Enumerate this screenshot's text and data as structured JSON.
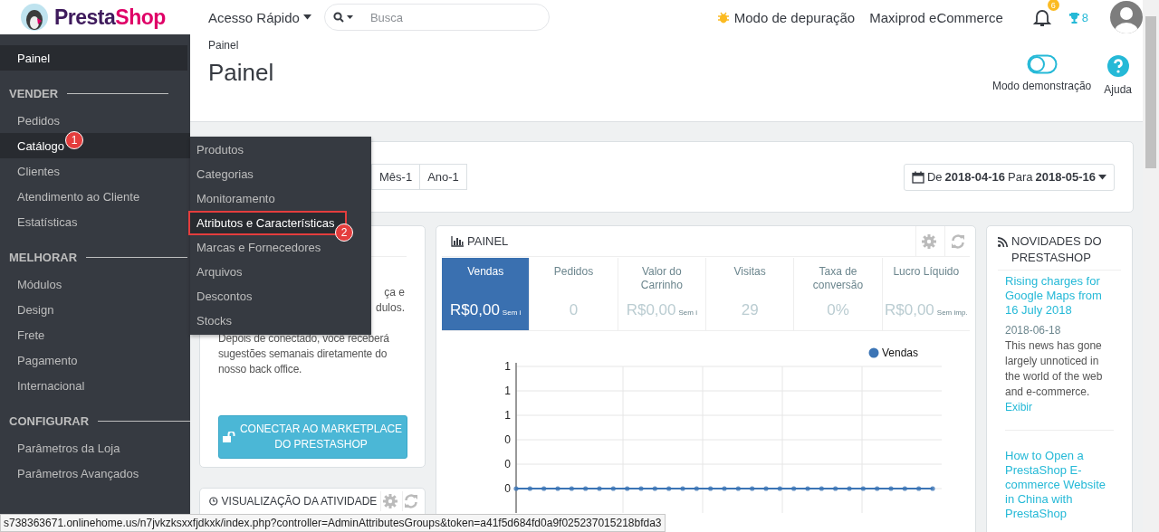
{
  "header": {
    "logo": [
      "Presta",
      "Shop"
    ],
    "quick_access": "Acesso Rápido",
    "search": {
      "placeholder": "Busca"
    },
    "debug_mode": "Modo de depuração",
    "shop_name": "Maxiprod eCommerce",
    "notifications_count": "6",
    "trophy_count": "8"
  },
  "sidebar": {
    "items": [
      {
        "label": "Painel",
        "selected": true
      },
      {
        "kind": "section",
        "label": "VENDER"
      },
      {
        "label": "Pedidos",
        "selected": false
      },
      {
        "label": "Catálogo",
        "selected": true,
        "badge": "1"
      },
      {
        "label": "Clientes",
        "selected": false
      },
      {
        "label": "Atendimento ao Cliente",
        "selected": false
      },
      {
        "label": "Estatísticas",
        "selected": false
      },
      {
        "kind": "section",
        "label": "MELHORAR"
      },
      {
        "label": "Módulos",
        "selected": false
      },
      {
        "label": "Design",
        "selected": false
      },
      {
        "label": "Frete",
        "selected": false
      },
      {
        "label": "Pagamento",
        "selected": false
      },
      {
        "label": "Internacional",
        "selected": false
      },
      {
        "kind": "section",
        "label": "CONFIGURAR"
      },
      {
        "label": "Parâmetros da Loja",
        "selected": false
      },
      {
        "label": "Parâmetros Avançados",
        "selected": false
      }
    ]
  },
  "submenu": {
    "items": [
      {
        "label": "Produtos",
        "selected": false,
        "outlined": false
      },
      {
        "label": "Categorias",
        "selected": false,
        "outlined": false
      },
      {
        "label": "Monitoramento",
        "selected": false,
        "outlined": false
      },
      {
        "label": "Atributos e Características",
        "selected": true,
        "outlined": true,
        "badge": "2"
      },
      {
        "label": "Marcas e Fornecedores",
        "selected": false,
        "outlined": false
      },
      {
        "label": "Arquivos",
        "selected": false,
        "outlined": false
      },
      {
        "label": "Descontos",
        "selected": false,
        "outlined": false
      },
      {
        "label": "Stocks",
        "selected": false,
        "outlined": false
      }
    ]
  },
  "page_header": {
    "breadcrumb": "Painel",
    "title": "Painel",
    "actions": [
      {
        "kind": "toggle",
        "label": "Modo demonstração"
      },
      {
        "kind": "help",
        "label": "Ajuda"
      }
    ]
  },
  "period_buttons": [
    "Mês-1",
    "Ano-1"
  ],
  "date_range": {
    "from_label": "De",
    "from": "2018-04-16",
    "to_label": "Para",
    "to": "2018-05-16"
  },
  "marketplace_card": {
    "fragments": [
      "ça e",
      "dulos."
    ],
    "text": "Depois de conectado, você receberá sugestões semanais diretamente do nosso back office.",
    "button": "CONECTAR AO MARKETPLACE DO PRESTASHOP"
  },
  "activity_card": {
    "title": "VISUALIZAÇÃO DA ATIVIDADE"
  },
  "dashboard_card": {
    "title": "PAINEL",
    "kpis": [
      {
        "label": "Vendas",
        "value": "R$0,00",
        "note": "Sem i",
        "selected": true
      },
      {
        "label": "Pedidos",
        "value": "0",
        "selected": false
      },
      {
        "label": "Valor do Carrinho",
        "value": "R$0,00",
        "note": "Sem i",
        "selected": false
      },
      {
        "label": "Visitas",
        "value": "29",
        "selected": false
      },
      {
        "label": "Taxa de conversão",
        "value": "0%",
        "selected": false
      },
      {
        "label": "Lucro Líquido",
        "value": "R$0,00",
        "note": "Sem imp.",
        "selected": false
      }
    ],
    "chart_data": {
      "type": "line",
      "ylim": [
        -0.2,
        1
      ],
      "grid": true,
      "yticks": [
        {
          "value": 1,
          "label": "1"
        },
        {
          "value": 0.8,
          "label": "1"
        },
        {
          "value": 0.6,
          "label": "1"
        },
        {
          "value": 0.4,
          "label": "0"
        },
        {
          "value": 0.2,
          "label": "0"
        },
        {
          "value": 0,
          "label": "0"
        }
      ],
      "series": [
        {
          "name": "Vendas",
          "color": "#3b74b5",
          "values": [
            0,
            0,
            0,
            0,
            0,
            0,
            0,
            0,
            0,
            0,
            0,
            0,
            0,
            0,
            0,
            0,
            0,
            0,
            0,
            0,
            0,
            0,
            0,
            0,
            0,
            0,
            0,
            0,
            0,
            0,
            0
          ]
        }
      ]
    }
  },
  "news_card": {
    "title": "NOVIDADES DO PRESTASHOP",
    "items": [
      {
        "title": "Rising charges for Google Maps from 16 July 2018",
        "date": "2018-06-18",
        "text": "This news has gone largely unnoticed in the world of the web and e-commerce.",
        "link": "Exibir"
      },
      {
        "title": "How to Open a PrestaShop E-commerce Website in China with PrestaShop"
      }
    ]
  },
  "status_url": "s738363671.onlinehome.us/n7jvkzksxxfjdkxk/index.php?controller=AdminAttributesGroups&token=a41f5d684fd0a9f025237015218bfda3"
}
